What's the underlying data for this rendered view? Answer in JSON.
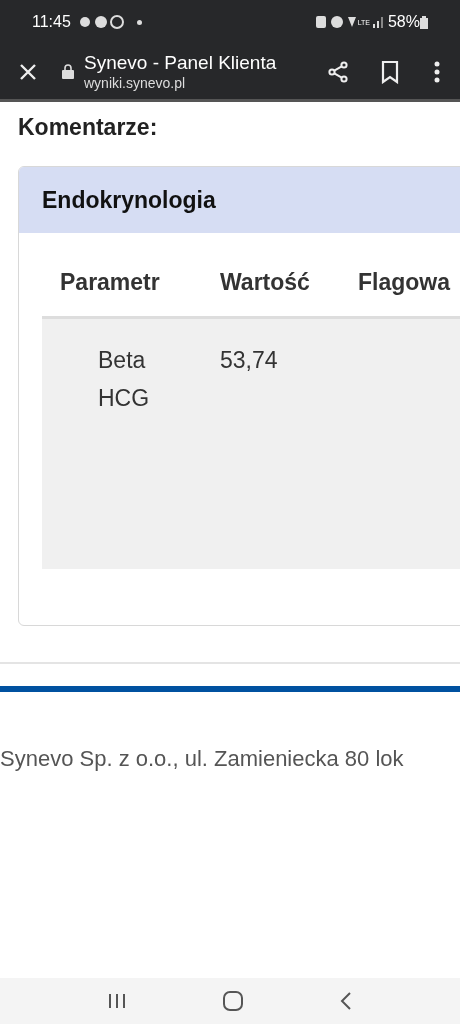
{
  "status_bar": {
    "time": "11:45",
    "battery": "58%",
    "network": "LTE"
  },
  "browser_bar": {
    "title": "Synevo - Panel Klienta",
    "url": "wyniki.synevo.pl"
  },
  "section_title": "Komentarze:",
  "card": {
    "title": "Endokrynologia",
    "table": {
      "columns": [
        "Parametr",
        "Wartość",
        "Flagowa"
      ],
      "rows": [
        {
          "parameter": "Beta HCG",
          "value": "53,74"
        }
      ]
    }
  },
  "footer": "Synevo Sp. z o.o., ul. Zamieniecka 80 lok"
}
